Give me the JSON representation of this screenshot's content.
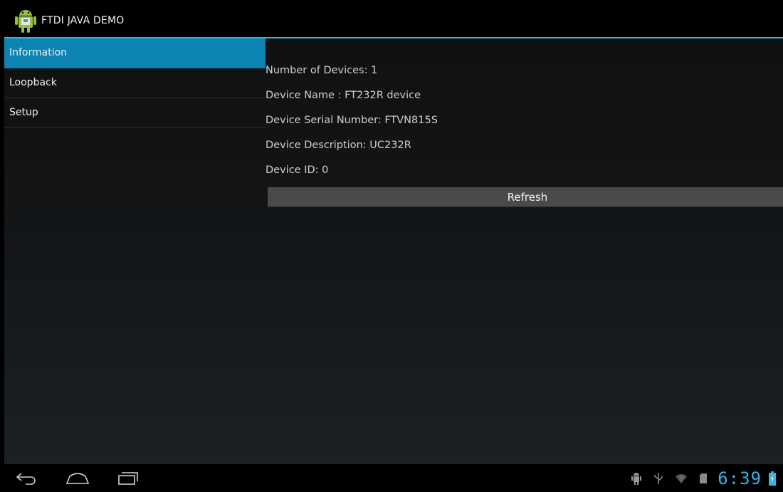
{
  "app": {
    "title": "FTDI JAVA DEMO",
    "icon": "android-robot-icon"
  },
  "sidebar": {
    "items": [
      {
        "label": "Information",
        "active": true
      },
      {
        "label": "Loopback",
        "active": false
      },
      {
        "label": "Setup",
        "active": false
      }
    ]
  },
  "info": {
    "num_devices": "Number of Devices: 1",
    "device_name": "Device Name : FT232R device",
    "serial": "Device Serial Number: FTVN815S",
    "description": "Device Description: UC232R",
    "device_id": "Device ID: 0"
  },
  "refresh_label": "Refresh",
  "status_bar": {
    "time": "6:39",
    "icons": [
      "android-debug-icon",
      "usb-icon",
      "wifi-icon",
      "sd-card-icon",
      "battery-charging-icon"
    ]
  },
  "navbar": {
    "buttons": [
      "back-icon",
      "home-icon",
      "recent-apps-icon"
    ]
  },
  "colors": {
    "accent": "#33b5e5",
    "selected": "#0e84b3",
    "button": "#4a4a4a"
  }
}
